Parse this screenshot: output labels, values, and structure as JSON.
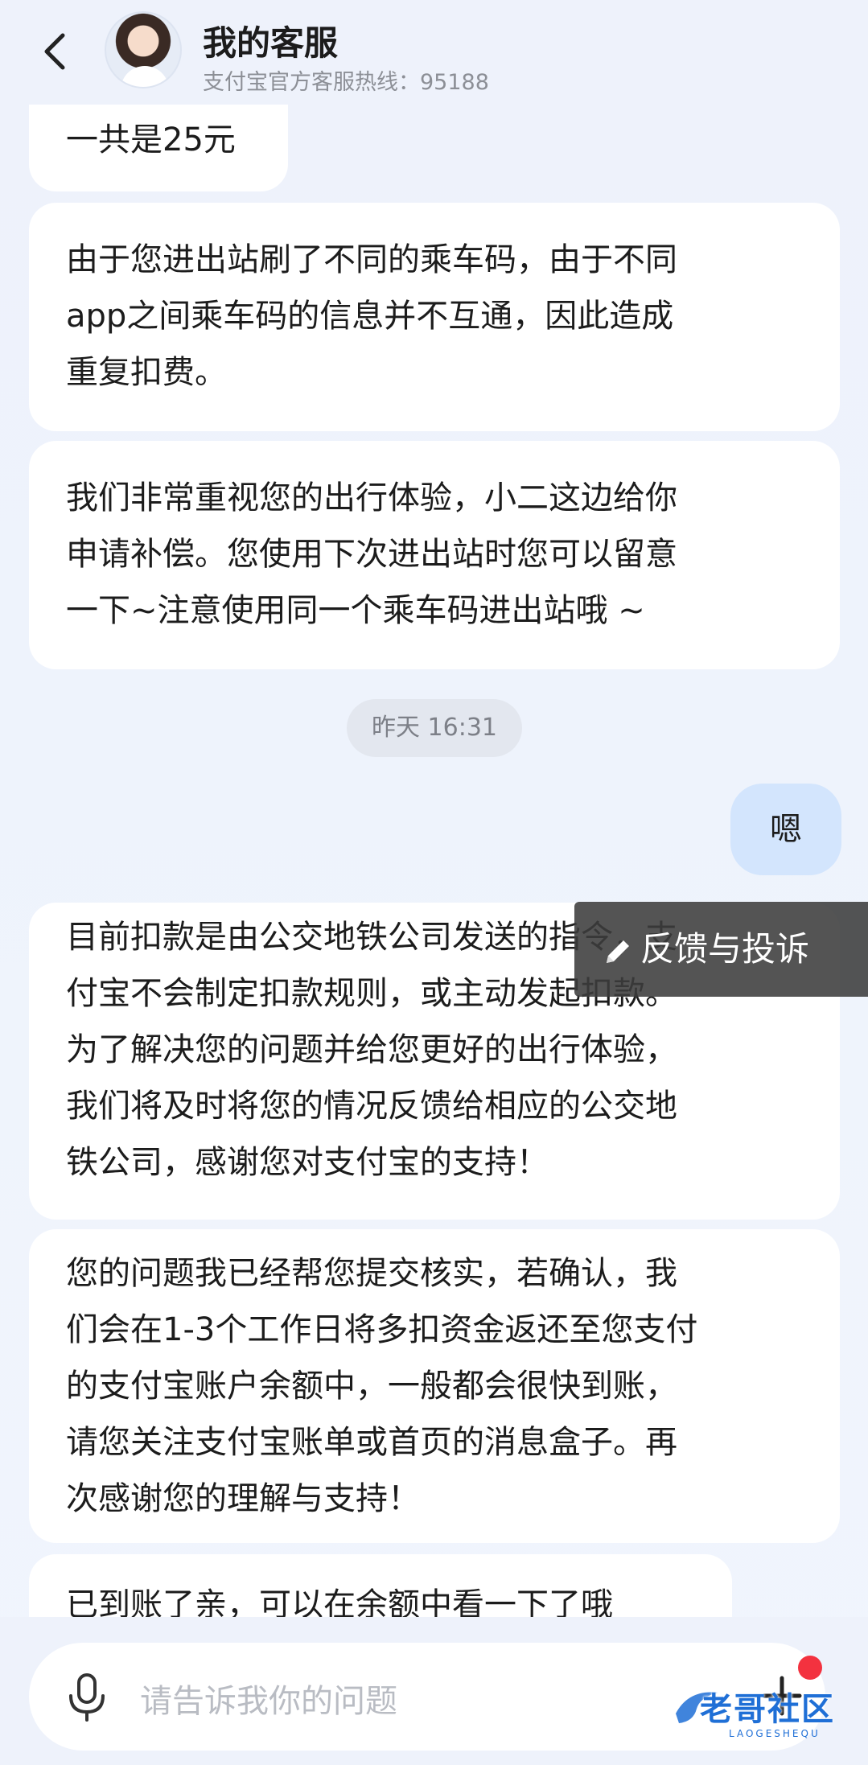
{
  "header": {
    "title": "我的客服",
    "subtitle": "支付宝官方客服热线：95188"
  },
  "messages": [
    {
      "side": "agent",
      "lines": [
        "一共是25元"
      ]
    },
    {
      "side": "agent",
      "lines": [
        "由于您进出站刷了不同的乘车码，由于不同",
        "app之间乘车码的信息并不互通，因此造成",
        "重复扣费。"
      ]
    },
    {
      "side": "agent",
      "lines": [
        "我们非常重视您的出行体验，小二这边给你",
        "申请补偿。您使用下次进出站时您可以留意",
        "一下~注意使用同一个乘车码进出站哦 ~"
      ]
    },
    {
      "side": "agent",
      "lines": [
        "目前扣款是由公交地铁公司发送的指令，支",
        "付宝不会制定扣款规则，或主动发起扣款。",
        "为了解决您的问题并给您更好的出行体验，",
        "我们将及时将您的情况反馈给相应的公交地",
        "铁公司，感谢您对支付宝的支持！"
      ]
    },
    {
      "side": "agent",
      "lines": [
        "您的问题我已经帮您提交核实，若确认，我",
        "们会在1-3个工作日将多扣资金返还至您支付",
        "的支付宝账户余额中，一般都会很快到账，",
        "请您关注支付宝账单或首页的消息盒子。再",
        "次感谢您的理解与支持！"
      ]
    },
    {
      "side": "agent",
      "lines": [
        "已到账了亲，可以在余额中看一下了哦"
      ]
    }
  ],
  "timestamp": "昨天 16:31",
  "user_message": "嗯",
  "tooltip": {
    "label": "反馈与投诉",
    "icon": "pencil-icon"
  },
  "input": {
    "placeholder": "请告诉我你的问题"
  },
  "watermark": {
    "text": "老哥社区",
    "sub": "LAOGESHEQU"
  },
  "colors": {
    "user_bubble": "#d3e5fd",
    "agent_bubble": "#ffffff",
    "notification_dot": "#f3323f"
  }
}
